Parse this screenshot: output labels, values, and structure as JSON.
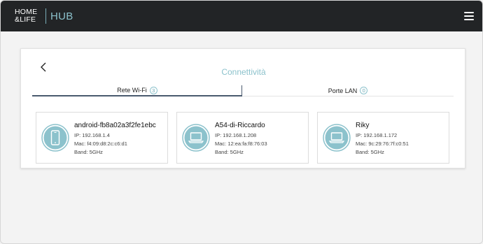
{
  "header": {
    "logo_line1": "HOME",
    "logo_line2": "&LIFE",
    "logo_hub": "HUB",
    "menu_icon": "hamburger-menu-icon"
  },
  "page": {
    "title": "Connettività",
    "back_icon": "chevron-left-icon"
  },
  "tabs": [
    {
      "label": "Rete Wi-Fi",
      "count": "3",
      "active": true
    },
    {
      "label": "Porte LAN",
      "count": "0",
      "active": false
    }
  ],
  "devices": [
    {
      "name": "android-fb8a02a3f2fe1ebc",
      "ip": "IP: 192.168.1.4",
      "mac": "Mac: f4:09:d8:2c:c6:d1",
      "band": "Band: 5GHz",
      "icon": "smartphone-icon"
    },
    {
      "name": "A54-di-Riccardo",
      "ip": "IP: 192.168.1.208",
      "mac": "Mac: 12:ea:fa:f8:76:03",
      "band": "Band: 5GHz",
      "icon": "laptop-icon"
    },
    {
      "name": "Riky",
      "ip": "IP: 192.168.1.172",
      "mac": "Mac: 9c:29:76:7f:c0:51",
      "band": "Band: 5GHz",
      "icon": "laptop-icon"
    }
  ],
  "colors": {
    "topbar": "#222426",
    "accent": "#8cc2cc",
    "icon_circle": "#8cc2cc",
    "active_tab_line": "#4a5a6e"
  }
}
